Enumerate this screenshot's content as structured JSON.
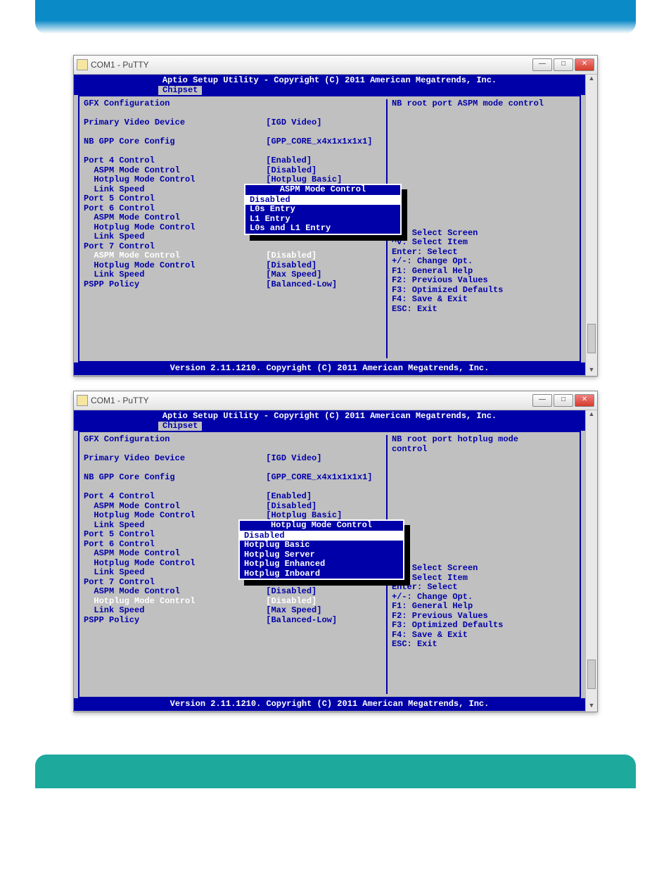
{
  "banner_top": "",
  "banner_bottom": "",
  "window1": {
    "title": "COM1 - PuTTY",
    "bios": {
      "header": "Aptio Setup Utility - Copyright (C) 2011 American Megatrends, Inc.",
      "tab": "Chipset",
      "footer": "Version 2.11.1210. Copyright (C) 2011 American Megatrends, Inc.",
      "help_title": "NB root port ASPM mode control",
      "rows": [
        {
          "label": "GFX Configuration",
          "value": ""
        },
        {
          "label": "",
          "value": ""
        },
        {
          "label": "Primary Video Device",
          "value": "[IGD Video]"
        },
        {
          "label": "",
          "value": ""
        },
        {
          "label": "NB GPP Core Config",
          "value": "[GPP_CORE_x4x1x1x1x1]"
        },
        {
          "label": "",
          "value": ""
        },
        {
          "label": "Port 4 Control",
          "value": "[Enabled]"
        },
        {
          "label": "  ASPM Mode Control",
          "value": "[Disabled]"
        },
        {
          "label": "  Hotplug Mode Control",
          "value": "[Hotplug Basic]"
        },
        {
          "label": "  Link Speed",
          "value": ""
        },
        {
          "label": "Port 5 Control",
          "value": ""
        },
        {
          "label": "Port 6 Control",
          "value": ""
        },
        {
          "label": "  ASPM Mode Control",
          "value": ""
        },
        {
          "label": "  Hotplug Mode Control",
          "value": ""
        },
        {
          "label": "  Link Speed",
          "value": ""
        },
        {
          "label": "Port 7 Control",
          "value": ""
        },
        {
          "label": "  ASPM Mode Control",
          "value": "[Disabled]",
          "selected": true
        },
        {
          "label": "  Hotplug Mode Control",
          "value": "[Disabled]"
        },
        {
          "label": "  Link Speed",
          "value": "[Max Speed]"
        },
        {
          "label": "PSPP Policy",
          "value": "[Balanced-Low]"
        }
      ],
      "popup": {
        "title": "ASPM Mode Control",
        "items": [
          "Disabled",
          "L0s Entry",
          "L1 Entry",
          "L0s and L1 Entry"
        ],
        "selected_index": 0
      },
      "help_keys": [
        "><: Select Screen",
        "^v: Select Item",
        "Enter: Select",
        "+/-: Change Opt.",
        "F1: General Help",
        "F2: Previous Values",
        "F3: Optimized Defaults",
        "F4: Save & Exit",
        "ESC: Exit"
      ]
    }
  },
  "window2": {
    "title": "COM1 - PuTTY",
    "bios": {
      "header": "Aptio Setup Utility - Copyright (C) 2011 American Megatrends, Inc.",
      "tab": "Chipset",
      "footer": "Version 2.11.1210. Copyright (C) 2011 American Megatrends, Inc.",
      "help_title": "NB root port hotplug mode\ncontrol",
      "rows": [
        {
          "label": "GFX Configuration",
          "value": ""
        },
        {
          "label": "",
          "value": ""
        },
        {
          "label": "Primary Video Device",
          "value": "[IGD Video]"
        },
        {
          "label": "",
          "value": ""
        },
        {
          "label": "NB GPP Core Config",
          "value": "[GPP_CORE_x4x1x1x1x1]"
        },
        {
          "label": "",
          "value": ""
        },
        {
          "label": "Port 4 Control",
          "value": "[Enabled]"
        },
        {
          "label": "  ASPM Mode Control",
          "value": "[Disabled]"
        },
        {
          "label": "  Hotplug Mode Control",
          "value": "[Hotplug Basic]"
        },
        {
          "label": "  Link Speed",
          "value": ""
        },
        {
          "label": "Port 5 Control",
          "value": ""
        },
        {
          "label": "Port 6 Control",
          "value": ""
        },
        {
          "label": "  ASPM Mode Control",
          "value": ""
        },
        {
          "label": "  Hotplug Mode Control",
          "value": ""
        },
        {
          "label": "  Link Speed",
          "value": ""
        },
        {
          "label": "Port 7 Control",
          "value": ""
        },
        {
          "label": "  ASPM Mode Control",
          "value": "[Disabled]"
        },
        {
          "label": "  Hotplug Mode Control",
          "value": "[Disabled]",
          "selected": true
        },
        {
          "label": "  Link Speed",
          "value": "[Max Speed]"
        },
        {
          "label": "PSPP Policy",
          "value": "[Balanced-Low]"
        }
      ],
      "popup": {
        "title": "Hotplug Mode Control",
        "items": [
          "Disabled",
          "Hotplug Basic",
          "Hotplug Server",
          "Hotplug Enhanced",
          "Hotplug Inboard"
        ],
        "selected_index": 0
      },
      "help_keys": [
        "><: Select Screen",
        "^v: Select Item",
        "Enter: Select",
        "+/-: Change Opt.",
        "F1: General Help",
        "F2: Previous Values",
        "F3: Optimized Defaults",
        "F4: Save & Exit",
        "ESC: Exit"
      ]
    }
  }
}
